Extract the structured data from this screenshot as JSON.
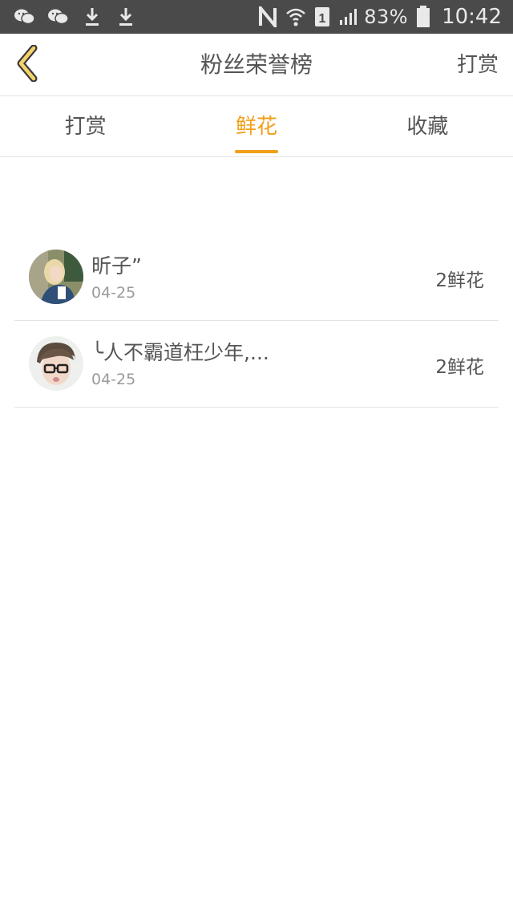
{
  "status_bar": {
    "battery": "83%",
    "time": "10:42",
    "icons_left": [
      "wechat-icon",
      "wechat-icon",
      "download-icon",
      "download-icon"
    ],
    "icons_right": [
      "nfc-icon",
      "wifi-icon",
      "sim-icon",
      "signal-icon",
      "battery-icon"
    ]
  },
  "header": {
    "title": "粉丝荣誉榜",
    "action_label": "打赏",
    "back_icon": "chevron-left-icon"
  },
  "tabs": [
    {
      "label": "打赏",
      "active": false
    },
    {
      "label": "鲜花",
      "active": true
    },
    {
      "label": "收藏",
      "active": false
    }
  ],
  "list": [
    {
      "name": "昕子”",
      "date": "04-25",
      "count": "2鲜花"
    },
    {
      "name": "╰人不霸道枉少年,...",
      "date": "04-25",
      "count": "2鲜花"
    }
  ],
  "colors": {
    "accent": "#f0a019",
    "statusbar_bg": "#4a4a4a",
    "text": "#555555",
    "subtext": "#9a9a9a",
    "divider": "#e4e4e4"
  }
}
